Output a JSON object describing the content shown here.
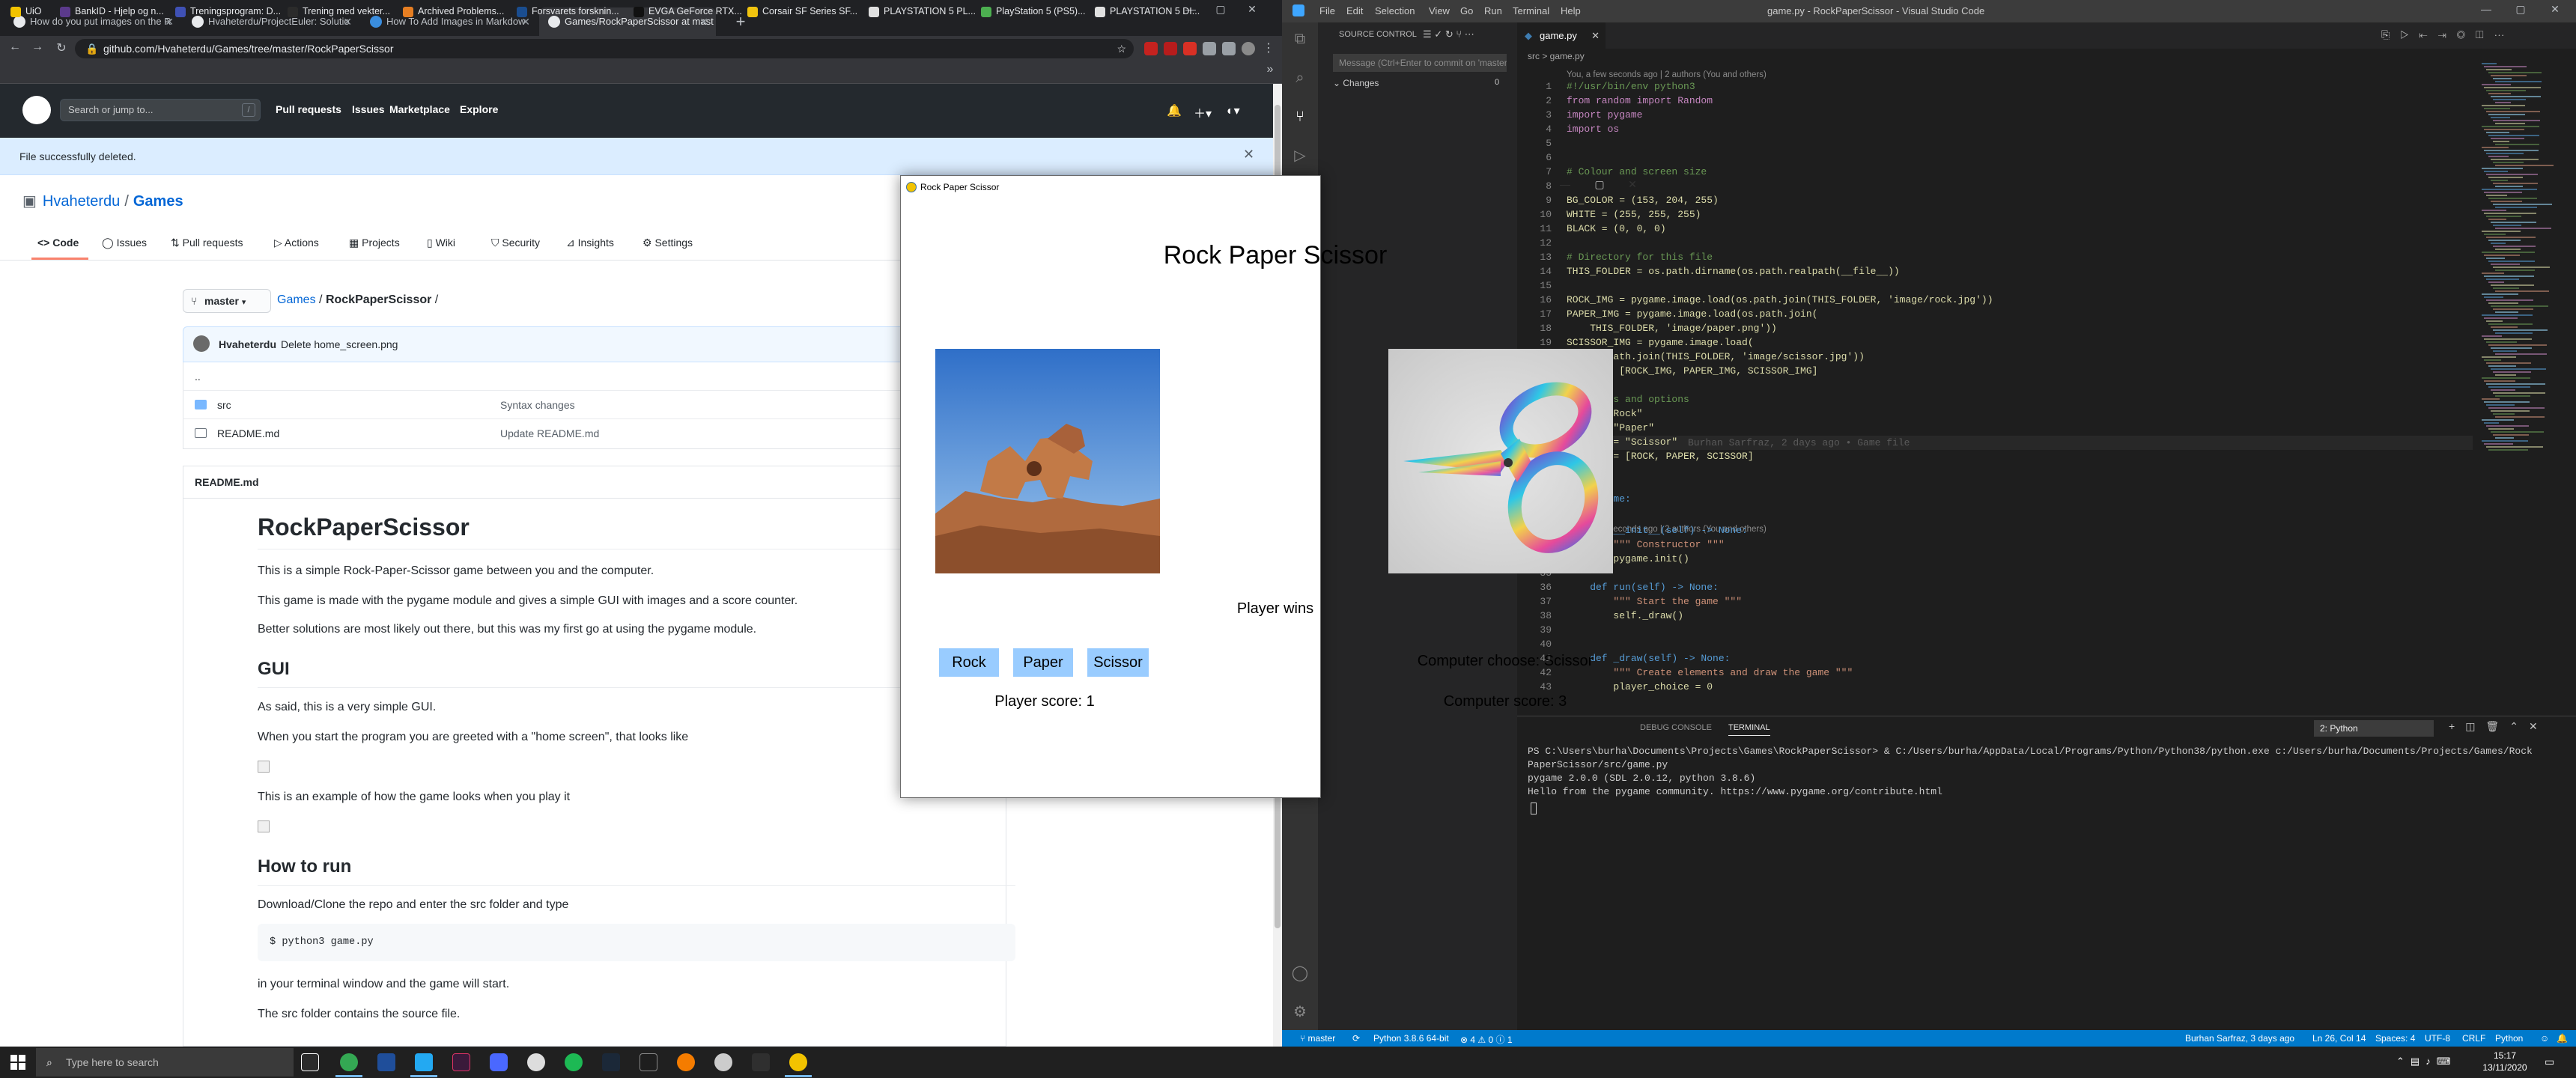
{
  "chrome": {
    "tabs": [
      {
        "label": "How do you put images on the R"
      },
      {
        "label": "Hvaheterdu/ProjectEuler: Solutio"
      },
      {
        "label": "How To Add Images in Markdow"
      },
      {
        "label": "Games/RockPaperScissor at mast"
      }
    ],
    "url": "github.com/Hvaheterdu/Games/tree/master/RockPaperScissor",
    "bookmarks": [
      "UiO",
      "BankID - Hjelp og n...",
      "Treningsprogram: D...",
      "Trening med vekter...",
      "Archived Problems...",
      "Forsvarets forsknin...",
      "EVGA GeForce RTX...",
      "Corsair SF Series SF...",
      "PLAYSTATION 5 PL...",
      "PlayStation 5 (PS5)...",
      "PLAYSTATION 5 DI..."
    ]
  },
  "github": {
    "search_placeholder": "Search or jump to...",
    "search_key": "/",
    "nav": [
      "Pull requests",
      "Issues",
      "Marketplace",
      "Explore"
    ],
    "flash": "File successfully deleted.",
    "owner": "Hvaheterdu",
    "repo": "Games",
    "repo_tabs": [
      "Code",
      "Issues",
      "Pull requests",
      "Actions",
      "Projects",
      "Wiki",
      "Security",
      "Insights",
      "Settings"
    ],
    "branch": "master",
    "breadcrumb": {
      "repo": "Games",
      "folder": "RockPaperScissor",
      "sep": "/"
    },
    "commit": {
      "author": "Hvaheterdu",
      "message": "Delete home_screen.png"
    },
    "files": [
      {
        "name": "..",
        "message": ""
      },
      {
        "name": "src",
        "message": "Syntax changes"
      },
      {
        "name": "README.md",
        "message": "Update README.md"
      }
    ],
    "readme": {
      "header": "README.md",
      "h1": "RockPaperScissor",
      "p1": "This is a simple Rock-Paper-Scissor game between you and the computer.",
      "p2": "This game is made with the pygame module and gives a simple GUI with images and a score counter.",
      "p3": "Better solutions are most likely out there, but this was my first go at using the pygame module.",
      "h2_gui": "GUI",
      "p4": "As said, this is a very simple GUI.",
      "p5": "When you start the program you are greeted with a \"home screen\", that looks like",
      "p6": "This is an example of how the game looks when you play it",
      "h2_run": "How to run",
      "p7": "Download/Clone the repo and enter the src folder and type",
      "code": "$ python3 game.py",
      "p8": "in your terminal window and the game will start.",
      "p9": "The src folder contains the source file."
    }
  },
  "vscode": {
    "title": "game.py - RockPaperScissor - Visual Studio Code",
    "menu": [
      "File",
      "Edit",
      "Selection",
      "View",
      "Go",
      "Run",
      "Terminal",
      "Help"
    ],
    "sidebar_title": "SOURCE CONTROL",
    "commit_placeholder": "Message (Ctrl+Enter to commit on 'master')",
    "changes_label": "Changes",
    "changes_count": "0",
    "tab": "game.py",
    "breadcrumb": "src > game.py",
    "blame_top": "You, a few seconds ago | 2 authors (You and others)",
    "blame_mid": "You, a few seconds ago | 2 authors (You and others)",
    "inline_blame": "Burhan Sarfraz, 2 days ago • Game file",
    "code_lines": [
      "#!/usr/bin/env python3",
      "from random import Random",
      "import pygame",
      "import os",
      "",
      "",
      "# Colour and screen size",
      "",
      "BG_COLOR = (153, 204, 255)",
      "WHITE = (255, 255, 255)",
      "BLACK = (0, 0, 0)",
      "",
      "# Directory for this file",
      "THIS_FOLDER = os.path.dirname(os.path.realpath(__file__))",
      "",
      "ROCK_IMG = pygame.image.load(os.path.join(THIS_FOLDER, 'image/rock.jpg'))",
      "PAPER_IMG = pygame.image.load(os.path.join(",
      "    THIS_FOLDER, 'image/paper.png'))",
      "SCISSOR_IMG = pygame.image.load(",
      "    os.path.join(THIS_FOLDER, 'image/scissor.jpg'))",
      "IMAGES = [ROCK_IMG, PAPER_IMG, SCISSOR_IMG]",
      "",
      "# Choices and options",
      "ROCK = \"Rock\"",
      "PAPER = \"Paper\"",
      "SCISSOR = \"Scissor\"",
      "OPTIONS = [ROCK, PAPER, SCISSOR]",
      "",
      "",
      "class Game:",
      "",
      "    def __init__(self) -> None:",
      "        \"\"\" Constructor \"\"\"",
      "        pygame.init()",
      "",
      "    def run(self) -> None:",
      "        \"\"\" Start the game \"\"\"",
      "        self._draw()",
      "",
      "",
      "    def _draw(self) -> None:",
      "        \"\"\" Create elements and draw the game \"\"\"",
      "        player_choice = 0"
    ],
    "panel_tabs": [
      "DEBUG CONSOLE",
      "TERMINAL"
    ],
    "terminal_select": "2: Python",
    "terminal_lines": [
      "PS C:\\Users\\burha\\Documents\\Projects\\Games\\RockPaperScissor> & C:/Users/burha/AppData/Local/Programs/Python/Python38/python.exe c:/Users/burha/Documents/Projects/Games/Rock",
      "PaperScissor/src/game.py",
      "pygame 2.0.0 (SDL 2.0.12, python 3.8.6)",
      "Hello from the pygame community. https://www.pygame.org/contribute.html"
    ],
    "status": {
      "branch": "master",
      "python": "Python 3.8.6 64-bit",
      "problems": "⊗ 4  ⚠ 0  ⓘ 1",
      "blame": "Burhan Sarfraz, 3 days ago",
      "position": "Ln 26, Col 14",
      "spaces": "Spaces: 4",
      "encoding": "UTF-8",
      "eol": "CRLF",
      "language": "Python"
    }
  },
  "game": {
    "window_title": "Rock Paper Scissor",
    "title": "Rock Paper Scissor",
    "result": "Player wins",
    "buttons": [
      "Rock",
      "Paper",
      "Scissor"
    ],
    "player_score": "Player score: 1",
    "computer_choice": "Computer choose: Scissor",
    "computer_score": "Computer score: 3"
  },
  "taskbar": {
    "search_placeholder": "Type here to search",
    "time": "15:17",
    "date": "13/11/2020"
  },
  "colors": {
    "game_button": "#99ccff",
    "github_header": "#24292e",
    "vscode_status": "#007acc",
    "flash": "#dbedff"
  }
}
